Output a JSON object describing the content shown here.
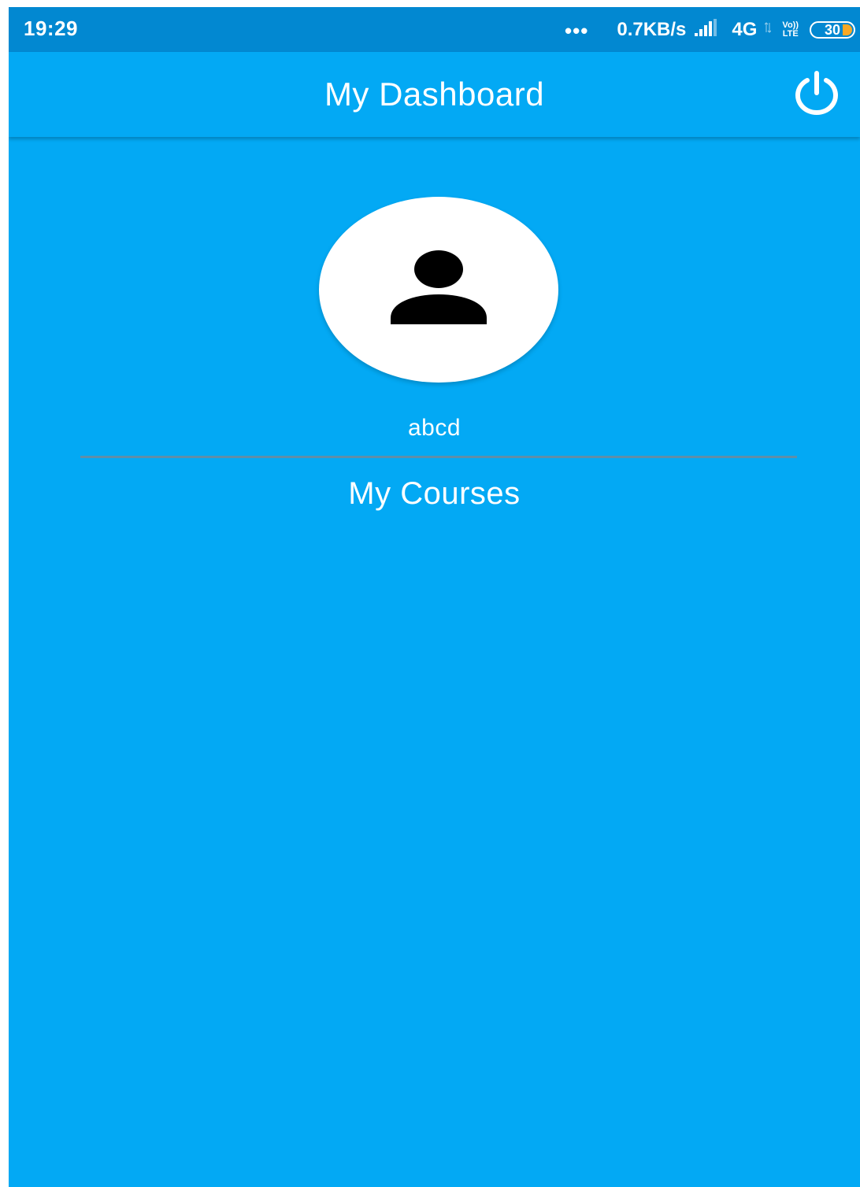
{
  "status_bar": {
    "time": "19:29",
    "dots": "•••",
    "speed": "0.7KB/s",
    "network": "4G",
    "volte_top": "Vo))",
    "volte_bottom": "LTE",
    "battery_level": "30",
    "icons": [
      "signal-icon",
      "battery-icon"
    ]
  },
  "app_bar": {
    "title": "My Dashboard",
    "power_icon": "power-icon"
  },
  "profile": {
    "avatar_icon": "person-icon",
    "username": "abcd"
  },
  "courses": {
    "title": "My Courses"
  },
  "colors": {
    "status_bar": "#0288d1",
    "primary": "#03a9f4",
    "text": "#ffffff",
    "battery_fill": "#f9a825"
  }
}
